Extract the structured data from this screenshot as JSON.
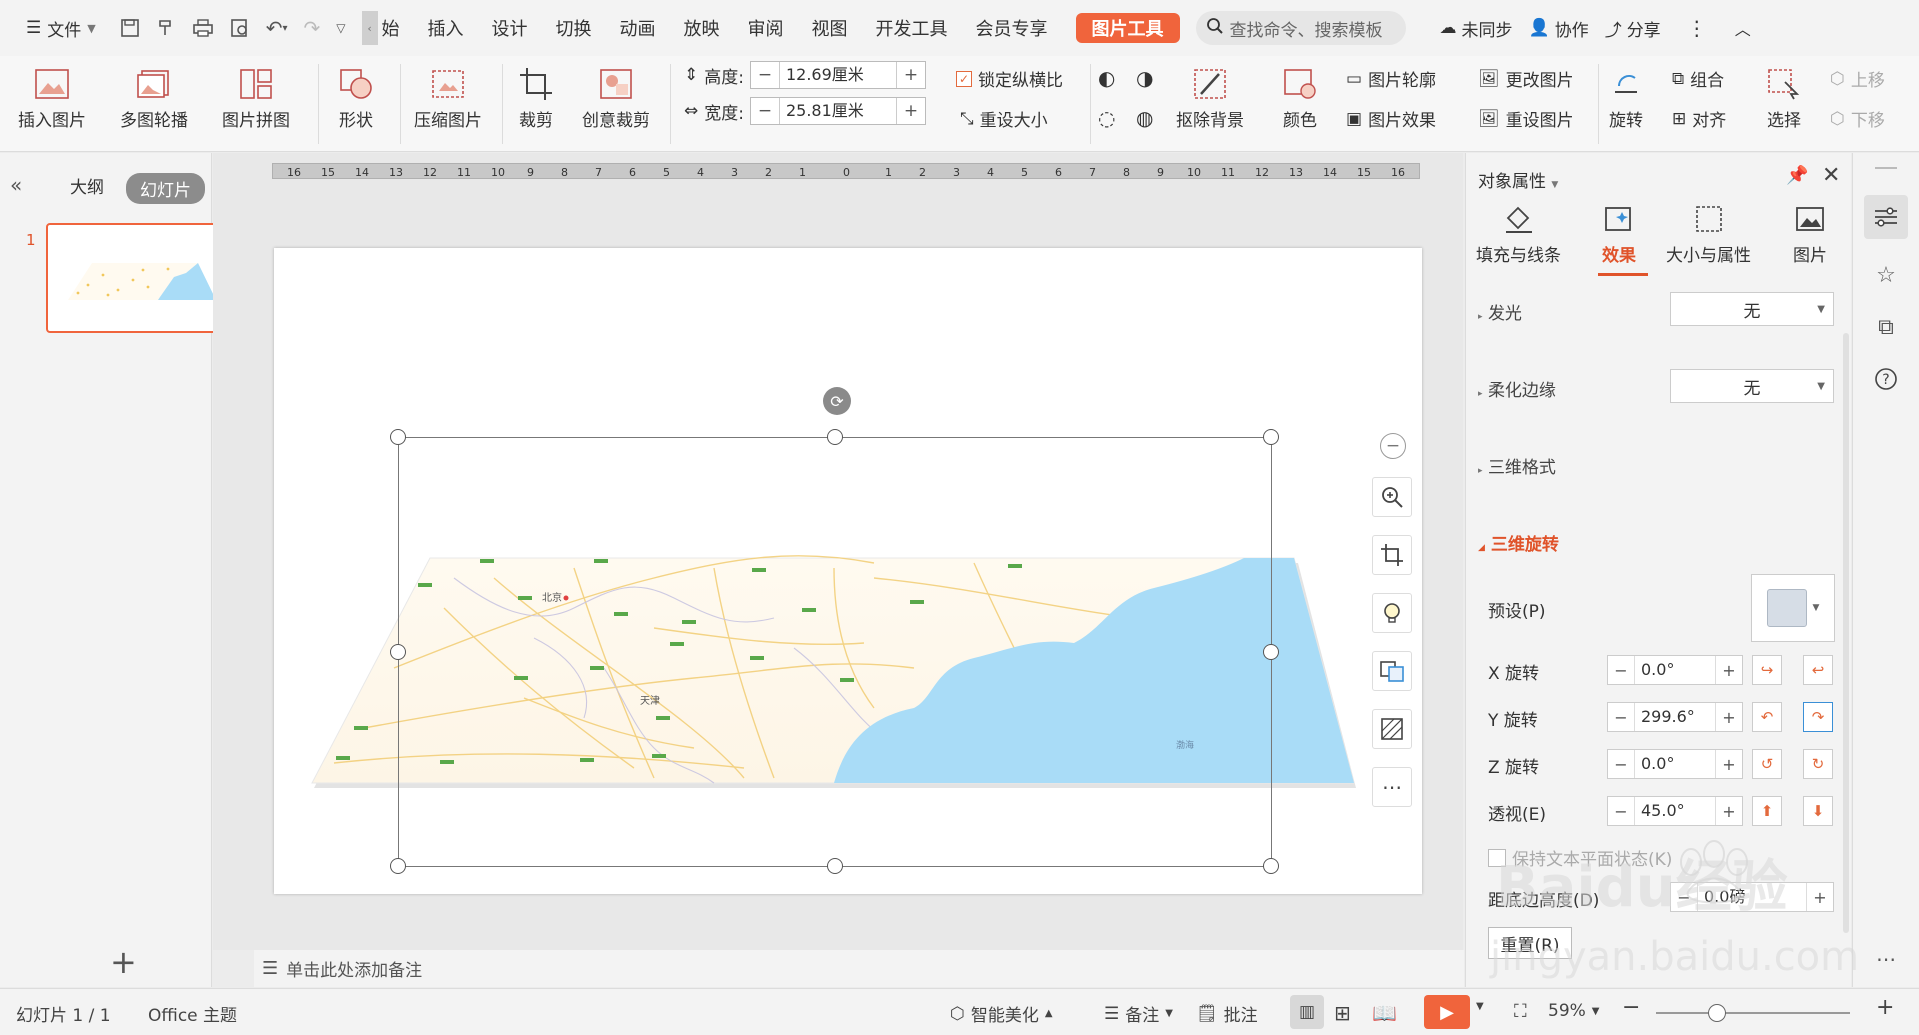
{
  "menubar": {
    "file": "文件",
    "tabs": [
      "始",
      "插入",
      "设计",
      "切换",
      "动画",
      "放映",
      "审阅",
      "视图",
      "开发工具",
      "会员专享"
    ],
    "picture_tool": "图片工具",
    "search_placeholder": "查找命令、搜索模板",
    "sync": "未同步",
    "collab": "协作",
    "share": "分享"
  },
  "ribbon": {
    "insert_picture": "插入图片",
    "multi_outline": "多图轮播",
    "collage": "图片拼图",
    "shape": "形状",
    "compress": "压缩图片",
    "crop": "裁剪",
    "creative_crop": "创意裁剪",
    "height_label": "高度:",
    "height_value": "12.69厘米",
    "width_label": "宽度:",
    "width_value": "25.81厘米",
    "lock_ratio": "锁定纵横比",
    "reset_size": "重设大小",
    "remove_bg": "抠除背景",
    "color": "颜色",
    "outline": "图片轮廓",
    "effects": "图片效果",
    "change_pic": "更改图片",
    "reset_pic": "重设图片",
    "rotate": "旋转",
    "group": "组合",
    "align": "对齐",
    "select": "选择",
    "bring_up": "上移",
    "send_down": "下移"
  },
  "leftpanel": {
    "outline_tab": "大纲",
    "slides_tab": "幻灯片",
    "slide_number": "1"
  },
  "notes": {
    "placeholder": "单击此处添加备注"
  },
  "map_labels": {
    "beijing": "北京",
    "tianjin": "天津",
    "bohai": "渤海"
  },
  "proppanel": {
    "title": "对象属性",
    "tabs": [
      "填充与线条",
      "效果",
      "大小与属性",
      "图片"
    ],
    "glow_label": "发光",
    "glow_value": "无",
    "soft_edge_label": "柔化边缘",
    "soft_edge_value": "无",
    "threed_format": "三维格式",
    "threed_rotation": "三维旋转",
    "preset_label": "预设(P)",
    "x_rotation_label": "X 旋转",
    "x_rotation_value": "0.0°",
    "y_rotation_label": "Y 旋转",
    "y_rotation_value": "299.6°",
    "z_rotation_label": "Z 旋转",
    "z_rotation_value": "0.0°",
    "perspective_label": "透视(E)",
    "perspective_value": "45.0°",
    "keep_text_flat": "保持文本平面状态(K)",
    "distance_label": "距底边高度(D)",
    "distance_value": "0.0磅",
    "reset": "重置(R)"
  },
  "statusbar": {
    "slide_info": "幻灯片 1 / 1",
    "theme": "Office 主题",
    "smart_beautify": "智能美化",
    "notes": "备注",
    "comments": "批注",
    "zoom": "59%"
  },
  "watermark": {
    "line1": "Baidu经验",
    "line2": "jingyan.baidu.com"
  },
  "colors": {
    "accent": "#f0643c",
    "active_tab": "#e0532a",
    "map_sea": "#a9dcf7"
  }
}
